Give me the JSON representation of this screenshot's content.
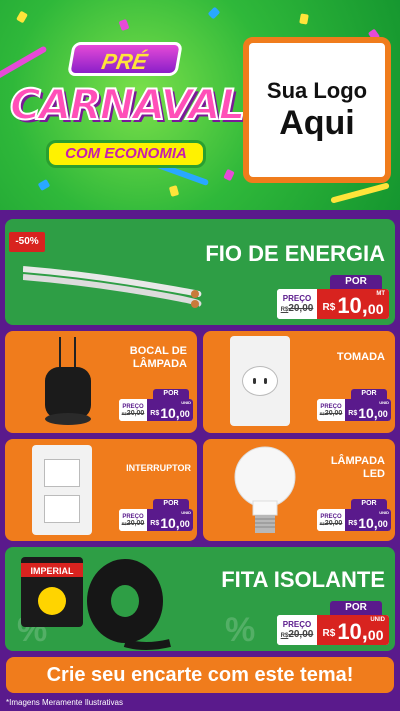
{
  "header": {
    "pre": "PRÉ",
    "carnaval": "CARNAVAL",
    "economia": "COM ECONOMIA",
    "logo_line1": "Sua Logo",
    "logo_line2": "Aqui"
  },
  "products": [
    {
      "title": "FIO DE ENERGIA",
      "badge": "-50%",
      "por": "POR",
      "preco": "PREÇO",
      "old_prefix": "R$",
      "old": "20,00",
      "new_prefix": "R$",
      "new_int": "10,",
      "new_dec": "00",
      "unit": "MT"
    },
    {
      "title_l1": "BOCAL DE",
      "title_l2": "LÂMPADA",
      "por": "POR",
      "preco": "PREÇO",
      "old_prefix": "R$",
      "old": "20,00",
      "new_prefix": "R$",
      "new_int": "10,",
      "new_dec": "00",
      "unit": "UNID"
    },
    {
      "title": "TOMADA",
      "por": "POR",
      "preco": "PREÇO",
      "old_prefix": "R$",
      "old": "20,00",
      "new_prefix": "R$",
      "new_int": "10,",
      "new_dec": "00",
      "unit": "UNID"
    },
    {
      "title": "INTERRUPTOR",
      "por": "POR",
      "preco": "PREÇO",
      "old_prefix": "R$",
      "old": "20,00",
      "new_prefix": "R$",
      "new_int": "10,",
      "new_dec": "00",
      "unit": "UNID"
    },
    {
      "title_l1": "LÂMPADA",
      "title_l2": "LED",
      "por": "POR",
      "preco": "PREÇO",
      "old_prefix": "R$",
      "old": "20,00",
      "new_prefix": "R$",
      "new_int": "10,",
      "new_dec": "00",
      "unit": "UNID"
    },
    {
      "title": "FITA ISOLANTE",
      "brand": "IMPERIAL",
      "por": "POR",
      "preco": "PREÇO",
      "old_prefix": "R$",
      "old": "20,00",
      "new_prefix": "R$",
      "new_int": "10,",
      "new_dec": "00",
      "unit": "UNID"
    }
  ],
  "footer": {
    "cta": "Crie seu encarte com este tema!",
    "disclaimer": "*Imagens Meramente Ilustrativas"
  },
  "colors": {
    "green": "#2e9e45",
    "orange": "#f07c1c",
    "purple": "#5a1a8c",
    "red": "#d8231f"
  }
}
